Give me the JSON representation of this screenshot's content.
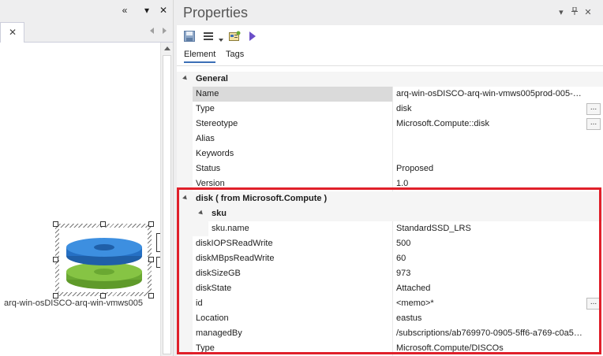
{
  "left_pane": {
    "tab_close": "✕",
    "element_label": "arq-win-osDISCO-arq-win-vmws005",
    "title_buttons": {
      "collapse": "«",
      "dropdown": "▾",
      "close": "✕"
    }
  },
  "props": {
    "title": "Properties",
    "title_buttons": {
      "dropdown": "▾",
      "pin": "ᵃ",
      "close": "✕"
    },
    "tabs": [
      "Element",
      "Tags"
    ],
    "general_label": "General",
    "general_rows": [
      {
        "name": "Name",
        "value": "arq-win-osDISCO-arq-win-vmws005prod-005-pr...",
        "ellipsis": false,
        "selected": true
      },
      {
        "name": "Type",
        "value": "disk",
        "ellipsis": true
      },
      {
        "name": "Stereotype",
        "value": "Microsoft.Compute::disk",
        "ellipsis": true
      },
      {
        "name": "Alias",
        "value": "",
        "ellipsis": false
      },
      {
        "name": "Keywords",
        "value": "",
        "ellipsis": false
      },
      {
        "name": "Status",
        "value": "Proposed",
        "ellipsis": false
      },
      {
        "name": "Version",
        "value": "1.0",
        "ellipsis": false
      }
    ],
    "disk_label": "disk  ( from Microsoft.Compute )",
    "sku_label": "sku",
    "sku_rows": [
      {
        "name": "sku.name",
        "value": "StandardSSD_LRS"
      }
    ],
    "disk_rows": [
      {
        "name": "diskIOPSReadWrite",
        "value": "500",
        "ellipsis": false
      },
      {
        "name": "diskMBpsReadWrite",
        "value": "60",
        "ellipsis": false
      },
      {
        "name": "diskSizeGB",
        "value": "973",
        "ellipsis": false
      },
      {
        "name": "diskState",
        "value": "Attached",
        "ellipsis": false
      },
      {
        "name": "id",
        "value": "<memo>*",
        "ellipsis": true
      },
      {
        "name": "Location",
        "value": "eastus",
        "ellipsis": false
      },
      {
        "name": "managedBy",
        "value": "/subscriptions/ab769970-0905-5ff6-a769-c0a505...",
        "ellipsis": false
      },
      {
        "name": "Type",
        "value": "Microsoft.Compute/DISCOs",
        "ellipsis": false
      }
    ]
  },
  "colors": {
    "highlight": "#e0202a",
    "disk_top": "#2b7fd6",
    "disk_bottom": "#78b83a",
    "accent": "#3b6fb6"
  }
}
